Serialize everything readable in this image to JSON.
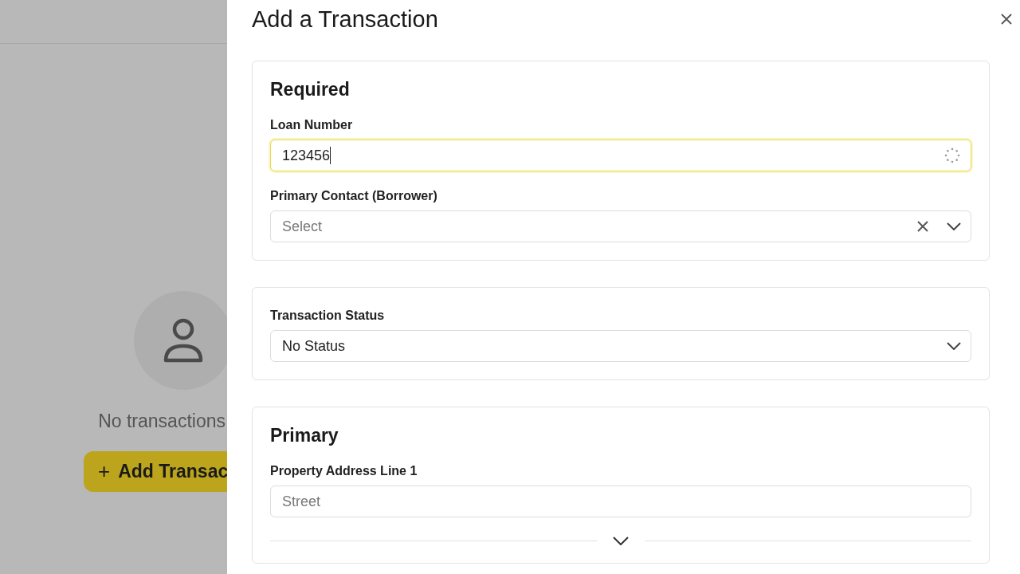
{
  "background": {
    "empty_message": "No transactions",
    "add_button": {
      "icon": "+",
      "label": "Add Transac"
    }
  },
  "drawer": {
    "title": "Add a Transaction"
  },
  "sections": [
    {
      "title": "Required",
      "expandable": false,
      "fields": [
        {
          "kind": "text",
          "label": "Loan Number",
          "value": "123456",
          "focused": true,
          "loading": true
        },
        {
          "kind": "select",
          "label": "Primary Contact (Borrower)",
          "placeholder": "Select",
          "clearable": true
        }
      ]
    },
    {
      "expandable": false,
      "fields": [
        {
          "kind": "select",
          "label": "Transaction Status",
          "value": "No Status",
          "clearable": false
        }
      ]
    },
    {
      "title": "Primary",
      "expandable": true,
      "fields": [
        {
          "kind": "text",
          "label": "Property Address Line 1",
          "placeholder": "Street",
          "focused": false,
          "loading": false
        }
      ]
    }
  ]
}
